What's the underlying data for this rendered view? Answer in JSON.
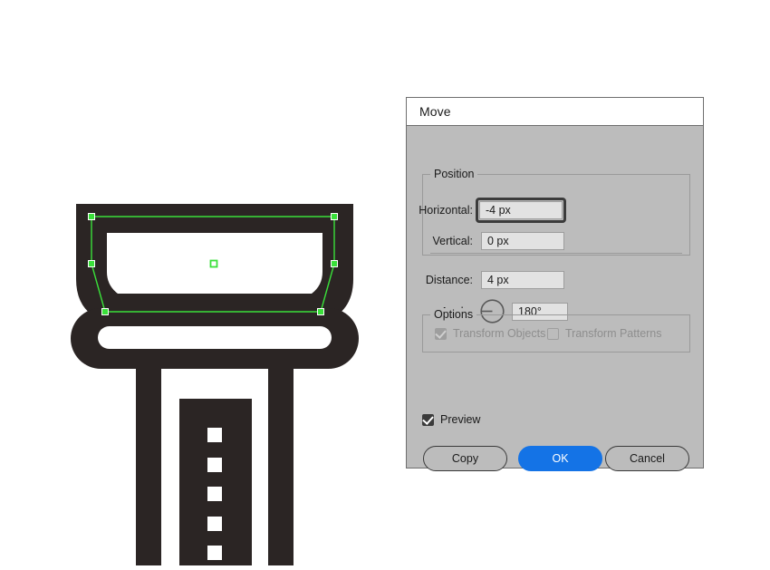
{
  "app": {
    "canvas_background": "#ffffff",
    "artwork_color": "#2b2524",
    "selection_color": "#3ae03a"
  },
  "dialog": {
    "title": "Move",
    "background": "#bcbcbc",
    "titlebar_background": "#ffffff",
    "border_color": "#6e6e6e",
    "position_group": {
      "legend": "Position",
      "fields": [
        {
          "label": "Horizontal:",
          "value": "-4 px",
          "focused": true
        },
        {
          "label": "Vertical:",
          "value": "0 px",
          "focused": false
        },
        {
          "label": "Distance:",
          "value": "4 px",
          "focused": false
        },
        {
          "label": "Angle:",
          "value": "180°",
          "focused": false
        }
      ],
      "angle_dial": {
        "icon": "angle-dial-icon",
        "degrees": 180
      }
    },
    "options_group": {
      "legend": "Options",
      "checkboxes": [
        {
          "label": "Transform Objects",
          "checked": true,
          "enabled": false
        },
        {
          "label": "Transform Patterns",
          "checked": false,
          "enabled": false
        }
      ]
    },
    "preview": {
      "label": "Preview",
      "checked": true,
      "enabled": true
    },
    "buttons": [
      {
        "label": "Copy",
        "style": "secondary"
      },
      {
        "label": "OK",
        "style": "primary",
        "accent": "#1473e6"
      },
      {
        "label": "Cancel",
        "style": "secondary"
      }
    ]
  },
  "artwork": {
    "description": "vector-illustration-selected-path",
    "fill_color": "#2b2524",
    "path_stroke": "#3ae03a",
    "anchor_fill": "#3ae03a",
    "center_point_label": "selection-center-point"
  }
}
